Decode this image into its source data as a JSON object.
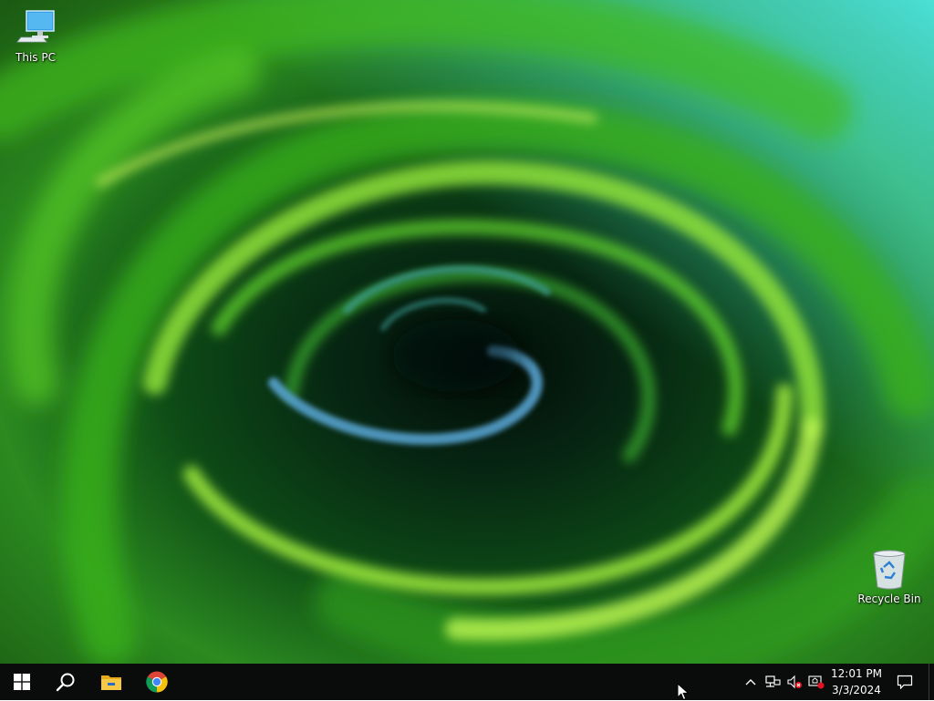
{
  "desktop": {
    "icons": [
      {
        "label": "This PC",
        "icon": "this-pc-icon"
      },
      {
        "label": "Recycle Bin",
        "icon": "recycle-bin-icon"
      }
    ]
  },
  "taskbar": {
    "buttons": [
      {
        "name": "Start",
        "icon": "windows-logo-icon"
      },
      {
        "name": "Search",
        "icon": "search-icon"
      },
      {
        "name": "File Explorer",
        "icon": "folder-icon"
      },
      {
        "name": "Google Chrome",
        "icon": "chrome-icon"
      }
    ],
    "tray": {
      "icons": [
        "chevron-up-icon",
        "network-disconnected-icon",
        "volume-muted-icon",
        "security-alert-icon"
      ]
    },
    "clock": {
      "time": "12:01 PM",
      "date": "3/3/2024"
    },
    "action_center_icon": "notification-icon"
  },
  "colors": {
    "taskbar": "#0a0c0b",
    "wallpaper_primary": "#4ec21a",
    "wallpaper_highlight": "#a6f04a",
    "wallpaper_cyan": "#4de6e0",
    "wallpaper_dark": "#031a0c"
  }
}
